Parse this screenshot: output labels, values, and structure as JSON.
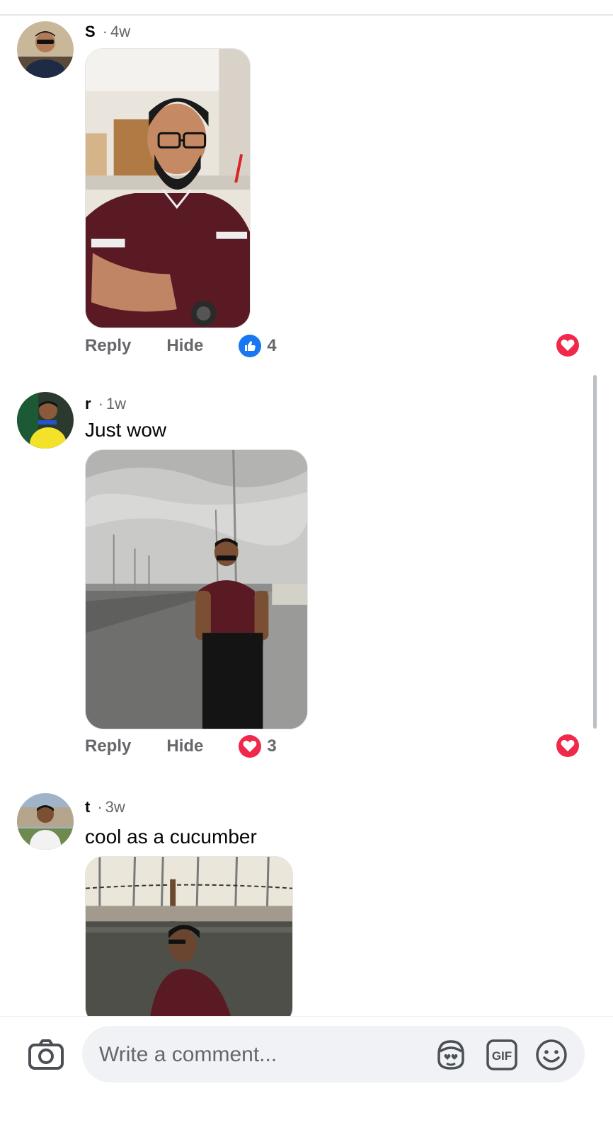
{
  "comments": [
    {
      "author": "S",
      "time": "4w",
      "text": "",
      "actions": {
        "reply": "Reply",
        "hide": "Hide"
      },
      "reaction": {
        "type": "like",
        "count": "4"
      },
      "liked_by_author": true
    },
    {
      "author": "r",
      "time": "1w",
      "text": "Just wow",
      "actions": {
        "reply": "Reply",
        "hide": "Hide"
      },
      "reaction": {
        "type": "love",
        "count": "3"
      },
      "liked_by_author": true
    },
    {
      "author": "t",
      "time": "3w",
      "text": "cool as a cucumber",
      "actions": {
        "reply": "Reply",
        "hide": "Hide"
      },
      "reaction": null,
      "liked_by_author": false
    }
  ],
  "composer": {
    "placeholder": "Write a comment...",
    "icons": [
      "camera-icon",
      "avatar-sticker-icon",
      "gif-icon",
      "emoji-icon"
    ]
  },
  "colors": {
    "like": "#1877f2",
    "love": "#f0284a",
    "secondary_text": "#65676b",
    "input_bg": "#f0f2f5"
  }
}
